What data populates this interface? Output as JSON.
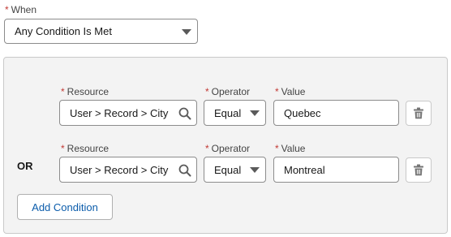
{
  "when": {
    "required_mark": "*",
    "label": "When",
    "selected": "Any Condition Is Met"
  },
  "conditions": [
    {
      "logic": "",
      "resource_label": "Resource",
      "resource_value": "User > Record > City",
      "operator_label": "Operator",
      "operator_value": "Equal",
      "value_label": "Value",
      "value": "Quebec",
      "required_mark": "*"
    },
    {
      "logic": "OR",
      "resource_label": "Resource",
      "resource_value": "User > Record > City",
      "operator_label": "Operator",
      "operator_value": "Equal",
      "value_label": "Value",
      "value": "Montreal",
      "required_mark": "*"
    }
  ],
  "add_condition_label": "Add Condition",
  "colors": {
    "required": "#c23934",
    "link": "#0b5cab",
    "panel_bg": "#f3f3f3"
  },
  "icons": {
    "dropdown": "chevron-down-icon",
    "search": "search-icon",
    "delete": "trash-icon"
  }
}
